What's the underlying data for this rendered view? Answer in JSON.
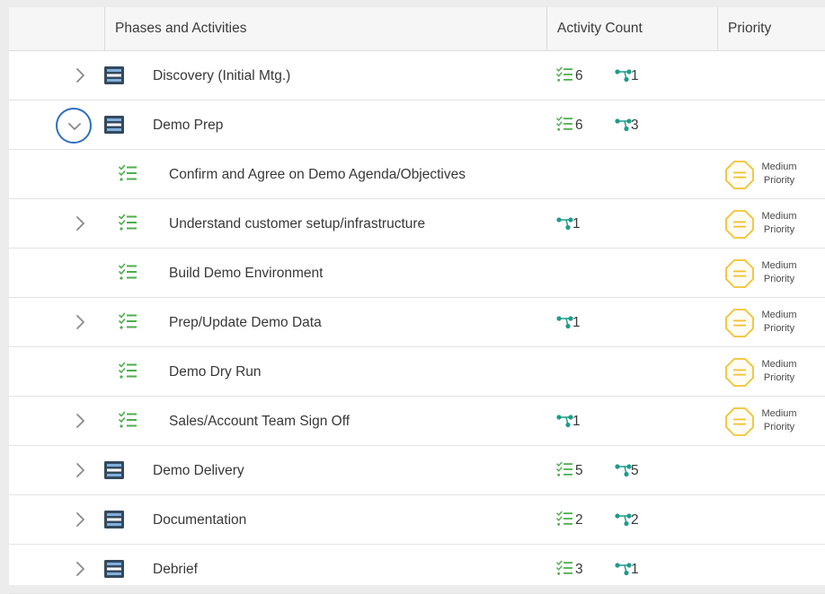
{
  "header": {
    "col_phases": "Phases and Activities",
    "col_count": "Activity Count",
    "col_priority": "Priority"
  },
  "colors": {
    "phase_icon_dark": "#34495e",
    "phase_icon_light": "#7fb0dd",
    "task_icon_green": "#4cae4c",
    "flow_icon_teal": "#1e9c8a",
    "priority_yellow": "#f2c232",
    "focus_ring_blue": "#2f6fc2"
  },
  "rows": [
    {
      "kind": "phase",
      "expandable": true,
      "expanded": false,
      "label": "Discovery (Initial Mtg.)",
      "tasks": "6",
      "flows": "1",
      "priority_line1": "",
      "priority_line2": ""
    },
    {
      "kind": "phase",
      "expandable": true,
      "expanded": true,
      "label": "Demo  Prep",
      "tasks": "6",
      "flows": "3",
      "priority_line1": "",
      "priority_line2": ""
    },
    {
      "kind": "task",
      "expandable": false,
      "expanded": false,
      "label": "Confirm and Agree on Demo Agenda/Objectives",
      "tasks": "",
      "flows": "",
      "priority_line1": "Medium",
      "priority_line2": "Priority"
    },
    {
      "kind": "task",
      "expandable": true,
      "expanded": false,
      "label": "Understand customer setup/infrastructure",
      "tasks": "",
      "flows": "1",
      "priority_line1": "Medium",
      "priority_line2": "Priority"
    },
    {
      "kind": "task",
      "expandable": false,
      "expanded": false,
      "label": "Build Demo Environment",
      "tasks": "",
      "flows": "",
      "priority_line1": "Medium",
      "priority_line2": "Priority"
    },
    {
      "kind": "task",
      "expandable": true,
      "expanded": false,
      "label": "Prep/Update Demo Data",
      "tasks": "",
      "flows": "1",
      "priority_line1": "Medium",
      "priority_line2": "Priority"
    },
    {
      "kind": "task",
      "expandable": false,
      "expanded": false,
      "label": "Demo  Dry Run",
      "tasks": "",
      "flows": "",
      "priority_line1": "Medium",
      "priority_line2": "Priority"
    },
    {
      "kind": "task",
      "expandable": true,
      "expanded": false,
      "label": "Sales/Account Team Sign Off",
      "tasks": "",
      "flows": "1",
      "priority_line1": "Medium",
      "priority_line2": "Priority"
    },
    {
      "kind": "phase",
      "expandable": true,
      "expanded": false,
      "label": "Demo Delivery",
      "tasks": "5",
      "flows": "5",
      "priority_line1": "",
      "priority_line2": ""
    },
    {
      "kind": "phase",
      "expandable": true,
      "expanded": false,
      "label": "Documentation",
      "tasks": "2",
      "flows": "2",
      "priority_line1": "",
      "priority_line2": ""
    },
    {
      "kind": "phase",
      "expandable": true,
      "expanded": false,
      "label": "Debrief",
      "tasks": "3",
      "flows": "1",
      "priority_line1": "",
      "priority_line2": ""
    }
  ]
}
